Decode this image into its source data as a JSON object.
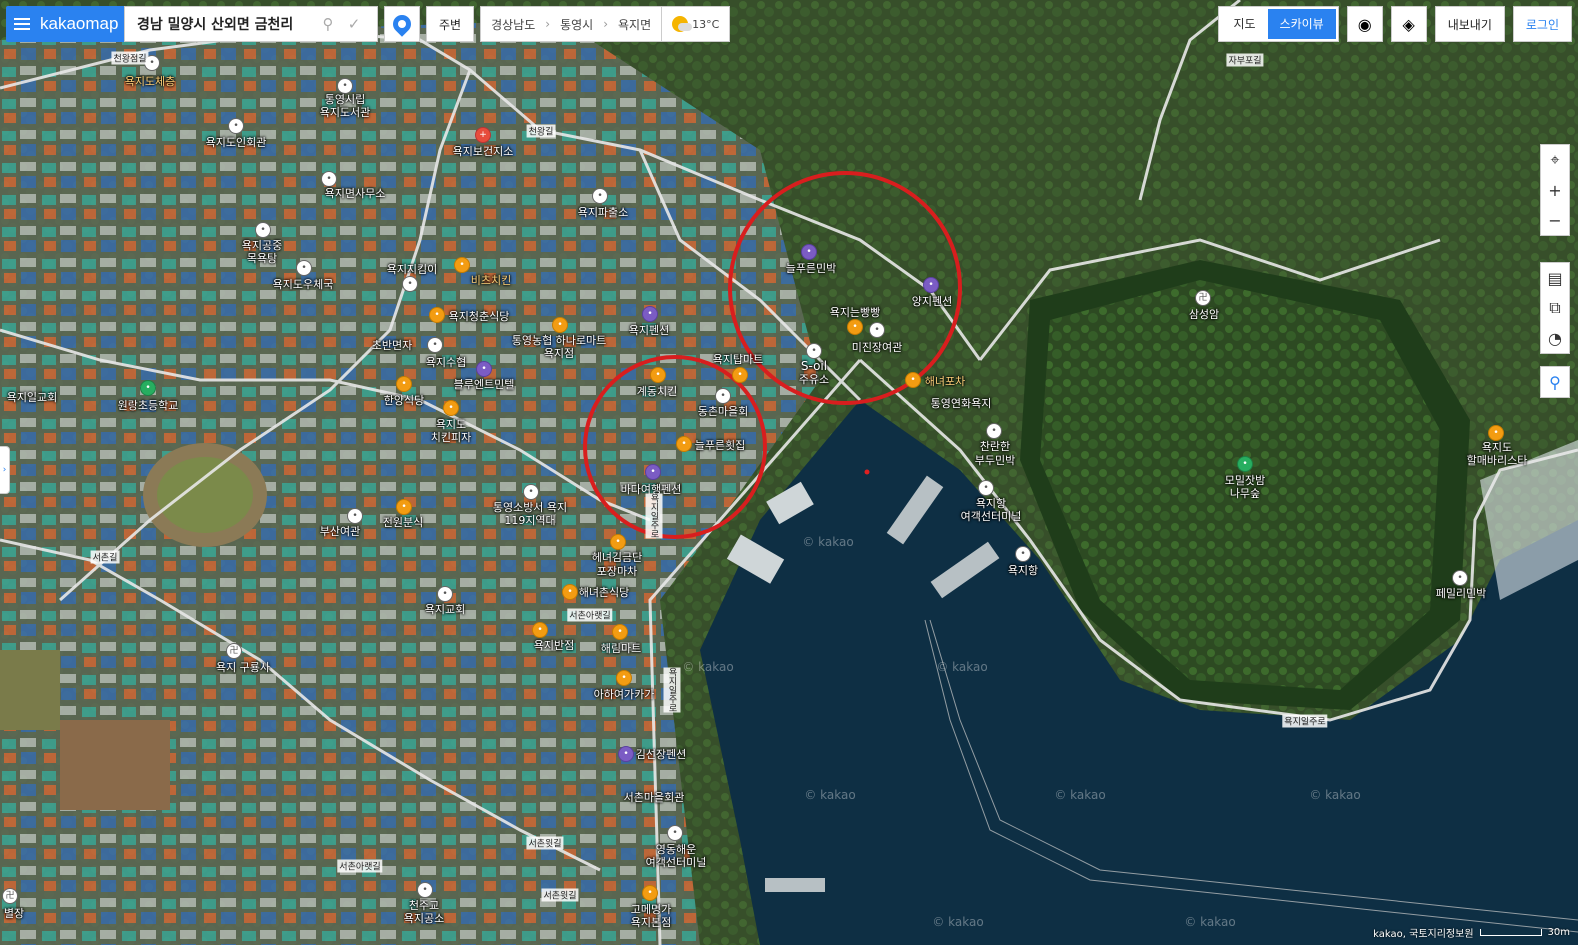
{
  "header": {
    "brand": "kakaomap",
    "search_value": "경남 밀양시 산외면 금천리",
    "nearby_label": "주변",
    "breadcrumb": [
      "경상남도",
      "통영시",
      "욕지면"
    ],
    "weather_temp": "13°C"
  },
  "top_right": {
    "map_label": "지도",
    "skyview_label": "스카이뷰",
    "export_label": "내보내기",
    "login_label": "로그인"
  },
  "labels": {
    "l1": "욕지도체층",
    "l2": "통영시립",
    "l3": "욕지도서관",
    "l4": "욕지도인회관",
    "l5": "욕지보건지소",
    "l6": "욕지면사무소",
    "l7": "욕지파출소",
    "l8": "욕지공중",
    "l9": "목욕탕",
    "l10": "욕지도우체국",
    "l11": "욕지지킴이",
    "l12": "비츠치킨",
    "l13": "욕지청춘식당",
    "l14": "통영농협 하나로마트",
    "l15": "욕지점",
    "l16": "초반면자",
    "l17": "욕지수협",
    "l18": "블루엔트민텔",
    "l19": "한양식당",
    "l20": "욕지도",
    "l21": "치킨피자",
    "l22": "욕지펜션",
    "l23": "계동치킨",
    "l24": "동촌마을회",
    "l25": "늘푸른횟집",
    "l26": "바다여행펜션",
    "l27": "통영소방서 욕지",
    "l28": "119지역대",
    "l29": "전원분식",
    "l30": "부산여관",
    "l31": "헤녀김금단",
    "l32": "포장마차",
    "l33": "해녀촌식당",
    "l34": "욕지교회",
    "l35": "욕지반점",
    "l36": "해림마트",
    "l37": "아하여가카가",
    "l38": "김선장펜션",
    "l39": "서촌마을회관",
    "l40": "영동해운",
    "l41": "여객선터미널",
    "l42": "천주교",
    "l43": "욕지공소",
    "l44": "고메명가",
    "l45": "욕지본점",
    "l46": "늘푸른민박",
    "l47": "양지펜션",
    "l48": "욕지는빵빵",
    "l49": "미진장여관",
    "l50": "S-oil",
    "l51": "주유소",
    "l52": "해녀포차",
    "l53": "통영연화욕지",
    "l54": "찬란한",
    "l55": "부두민박",
    "l56": "욕지항",
    "l57": "여객선터미널",
    "l58": "욕지항",
    "l59": "삼성암",
    "l60": "모밀잣밤",
    "l61": "나무숲",
    "l62": "페밀리민박",
    "l63": "욕지도",
    "l64": "할매바리스타",
    "l65": "원랑초등학교",
    "l66": "욕지일교회",
    "l67": "욕지 구룡사",
    "l68": "욕지탑마트",
    "l69": "별장"
  },
  "roads": {
    "r1": "천왕점길",
    "r2": "욕지일주로",
    "r3": "서촌아랫길",
    "r4": "욕지일주로",
    "r5": "서촌길",
    "r6": "천왕길",
    "r7": "자부포길",
    "r8": "서촌아랫길",
    "r9": "서촌윗길",
    "r10": "서촌윗길",
    "r11": "욕지일주로"
  },
  "watermark": "© kakao",
  "copyright": "kakao, 국토지리정보원",
  "scale_label": "30m",
  "colors": {
    "accent": "#2a82f0",
    "circle": "#d81e1e",
    "sea": "#0e2f44"
  }
}
